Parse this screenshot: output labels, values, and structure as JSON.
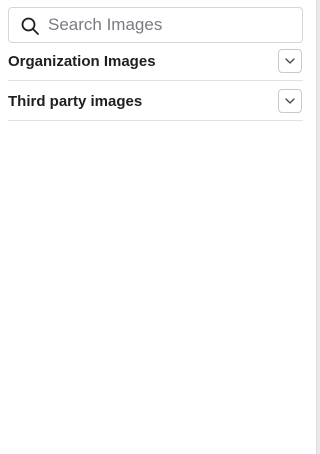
{
  "search": {
    "placeholder": "Search Images",
    "value": "",
    "icon": "search-icon"
  },
  "sections": [
    {
      "label": "Organization Images",
      "expanded": false,
      "icon": "chevron-down-icon"
    },
    {
      "label": "Third party images",
      "expanded": false,
      "icon": "chevron-down-icon"
    }
  ]
}
